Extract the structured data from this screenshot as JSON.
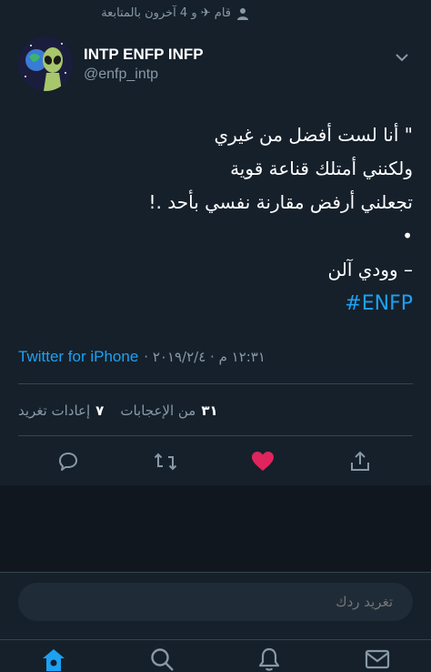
{
  "social_context": {
    "text": "قام ﻿✈ و 4 آخرون بالمتابعة"
  },
  "author": {
    "name": "INTP ENFP INFP",
    "handle": "@enfp_intp"
  },
  "tweet": {
    "lines": [
      "\" أنا لست أفضل من غيري",
      "ولكنني أمتلك قناعة قوية",
      "تجعلني أرفض مقارنة نفسي بأحد .!",
      "•",
      "– وودي آلن"
    ],
    "hashtag": "#ENFP"
  },
  "meta": {
    "source": "Twitter for iPhone",
    "time": "١٢:٣١ م · ٢٠١٩/٢/٤ ·"
  },
  "stats": {
    "likes_count": "٣١",
    "likes_label": "من الإعجابات",
    "retweets_count": "٧",
    "retweets_label": "إعادات تغريد"
  },
  "actions": {
    "reply_icon": "reply-icon",
    "retweet_icon": "retweet-icon",
    "like_icon": "heart-icon",
    "share_icon": "share-icon",
    "like_color": "#e0245e"
  },
  "compose": {
    "placeholder": "تغريد ردك"
  },
  "nav": {
    "items": [
      "home-icon",
      "search-icon",
      "notifications-icon",
      "messages-icon"
    ],
    "active_color": "#1da1f2"
  },
  "colors": {
    "background": "#15202b",
    "accent": "#1da1f2",
    "secondary_text": "#8899a6"
  }
}
